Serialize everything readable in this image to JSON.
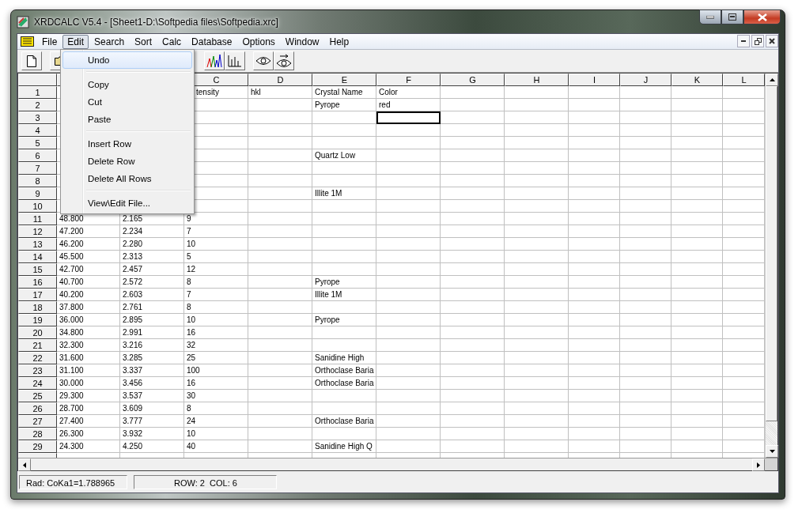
{
  "window": {
    "title": "XRDCALC V5.4 - [Sheet1-D:\\Softpedia files\\Softpedia.xrc]"
  },
  "menu": {
    "items": [
      {
        "label": "File",
        "selected": false
      },
      {
        "label": "Edit",
        "selected": true
      },
      {
        "label": "Search",
        "selected": false
      },
      {
        "label": "Sort",
        "selected": false
      },
      {
        "label": "Calc",
        "selected": false
      },
      {
        "label": "Database",
        "selected": false
      },
      {
        "label": "Options",
        "selected": false
      },
      {
        "label": "Window",
        "selected": false
      },
      {
        "label": "Help",
        "selected": false
      }
    ]
  },
  "dropdown": {
    "items": [
      {
        "kind": "item",
        "label": "Undo",
        "selected": true
      },
      {
        "kind": "separator"
      },
      {
        "kind": "item",
        "label": "Copy",
        "selected": false
      },
      {
        "kind": "item",
        "label": "Cut",
        "selected": false
      },
      {
        "kind": "item",
        "label": "Paste",
        "selected": false
      },
      {
        "kind": "separator"
      },
      {
        "kind": "item",
        "label": "Insert Row",
        "selected": false
      },
      {
        "kind": "item",
        "label": "Delete Row",
        "selected": false
      },
      {
        "kind": "item",
        "label": "Delete All Rows",
        "selected": false
      },
      {
        "kind": "separator"
      },
      {
        "kind": "item",
        "label": "View\\Edit File...",
        "selected": false
      }
    ]
  },
  "sheet": {
    "columns": [
      {},
      {},
      {
        "label": "C"
      },
      {
        "label": "D"
      },
      {
        "label": "E"
      },
      {
        "label": "F"
      },
      {
        "label": "G"
      },
      {
        "label": "H"
      },
      {
        "label": "I"
      },
      {
        "label": "J"
      },
      {
        "label": "K"
      },
      {
        "label": "L"
      }
    ],
    "rows": [
      {
        "label": "1",
        "cells": {
          "C": "tensity",
          "D": "hkl",
          "E": "Crystal Name",
          "F": "Color"
        }
      },
      {
        "label": "2",
        "cells": {
          "E": "Pyrope",
          "F": "red"
        }
      },
      {
        "label": "3",
        "cells": {
          "F": {
            "selected": true
          }
        }
      },
      {
        "label": "4",
        "cells": {}
      },
      {
        "label": "5",
        "cells": {}
      },
      {
        "label": "6",
        "cells": {
          "E": "Quartz Low"
        }
      },
      {
        "label": "7",
        "cells": {}
      },
      {
        "label": "8",
        "cells": {}
      },
      {
        "label": "9",
        "cells": {
          "E": "Illite 1M"
        }
      },
      {
        "label": "10",
        "cells": {}
      },
      {
        "label": "11",
        "cells": {
          "A": "48.800",
          "B": "2.165",
          "C": "9"
        }
      },
      {
        "label": "12",
        "cells": {
          "A": "47.200",
          "B": "2.234",
          "C": "7"
        }
      },
      {
        "label": "13",
        "cells": {
          "A": "46.200",
          "B": "2.280",
          "C": "10"
        }
      },
      {
        "label": "14",
        "cells": {
          "A": "45.500",
          "B": "2.313",
          "C": "5"
        }
      },
      {
        "label": "15",
        "cells": {
          "A": "42.700",
          "B": "2.457",
          "C": "12"
        }
      },
      {
        "label": "16",
        "cells": {
          "A": "40.700",
          "B": "2.572",
          "C": "8",
          "E": "Pyrope"
        }
      },
      {
        "label": "17",
        "cells": {
          "A": "40.200",
          "B": "2.603",
          "C": "7",
          "E": "Illite 1M"
        }
      },
      {
        "label": "18",
        "cells": {
          "A": "37.800",
          "B": "2.761",
          "C": "8"
        }
      },
      {
        "label": "19",
        "cells": {
          "A": "36.000",
          "B": "2.895",
          "C": "10",
          "E": "Pyrope"
        }
      },
      {
        "label": "20",
        "cells": {
          "A": "34.800",
          "B": "2.991",
          "C": "16"
        }
      },
      {
        "label": "21",
        "cells": {
          "A": "32.300",
          "B": "3.216",
          "C": "32"
        }
      },
      {
        "label": "22",
        "cells": {
          "A": "31.600",
          "B": "3.285",
          "C": "25",
          "E": "Sanidine High"
        }
      },
      {
        "label": "23",
        "cells": {
          "A": "31.100",
          "B": "3.337",
          "C": "100",
          "E": "Orthoclase Baria"
        }
      },
      {
        "label": "24",
        "cells": {
          "A": "30.000",
          "B": "3.456",
          "C": "16",
          "E": "Orthoclase Baria"
        }
      },
      {
        "label": "25",
        "cells": {
          "A": "29.300",
          "B": "3.537",
          "C": "30"
        }
      },
      {
        "label": "26",
        "cells": {
          "A": "28.700",
          "B": "3.609",
          "C": "8"
        }
      },
      {
        "label": "27",
        "cells": {
          "A": "27.400",
          "B": "3.777",
          "C": "24",
          "E": "Orthoclase Baria"
        }
      },
      {
        "label": "28",
        "cells": {
          "A": "26.300",
          "B": "3.932",
          "C": "10"
        }
      },
      {
        "label": "29",
        "cells": {
          "A": "24.300",
          "B": "4.250",
          "C": "40",
          "E": "Sanidine High Q"
        }
      }
    ]
  },
  "status_bar": [
    "Rad: CoKa1=1.788965",
    "ROW: 2  COL: 6"
  ]
}
